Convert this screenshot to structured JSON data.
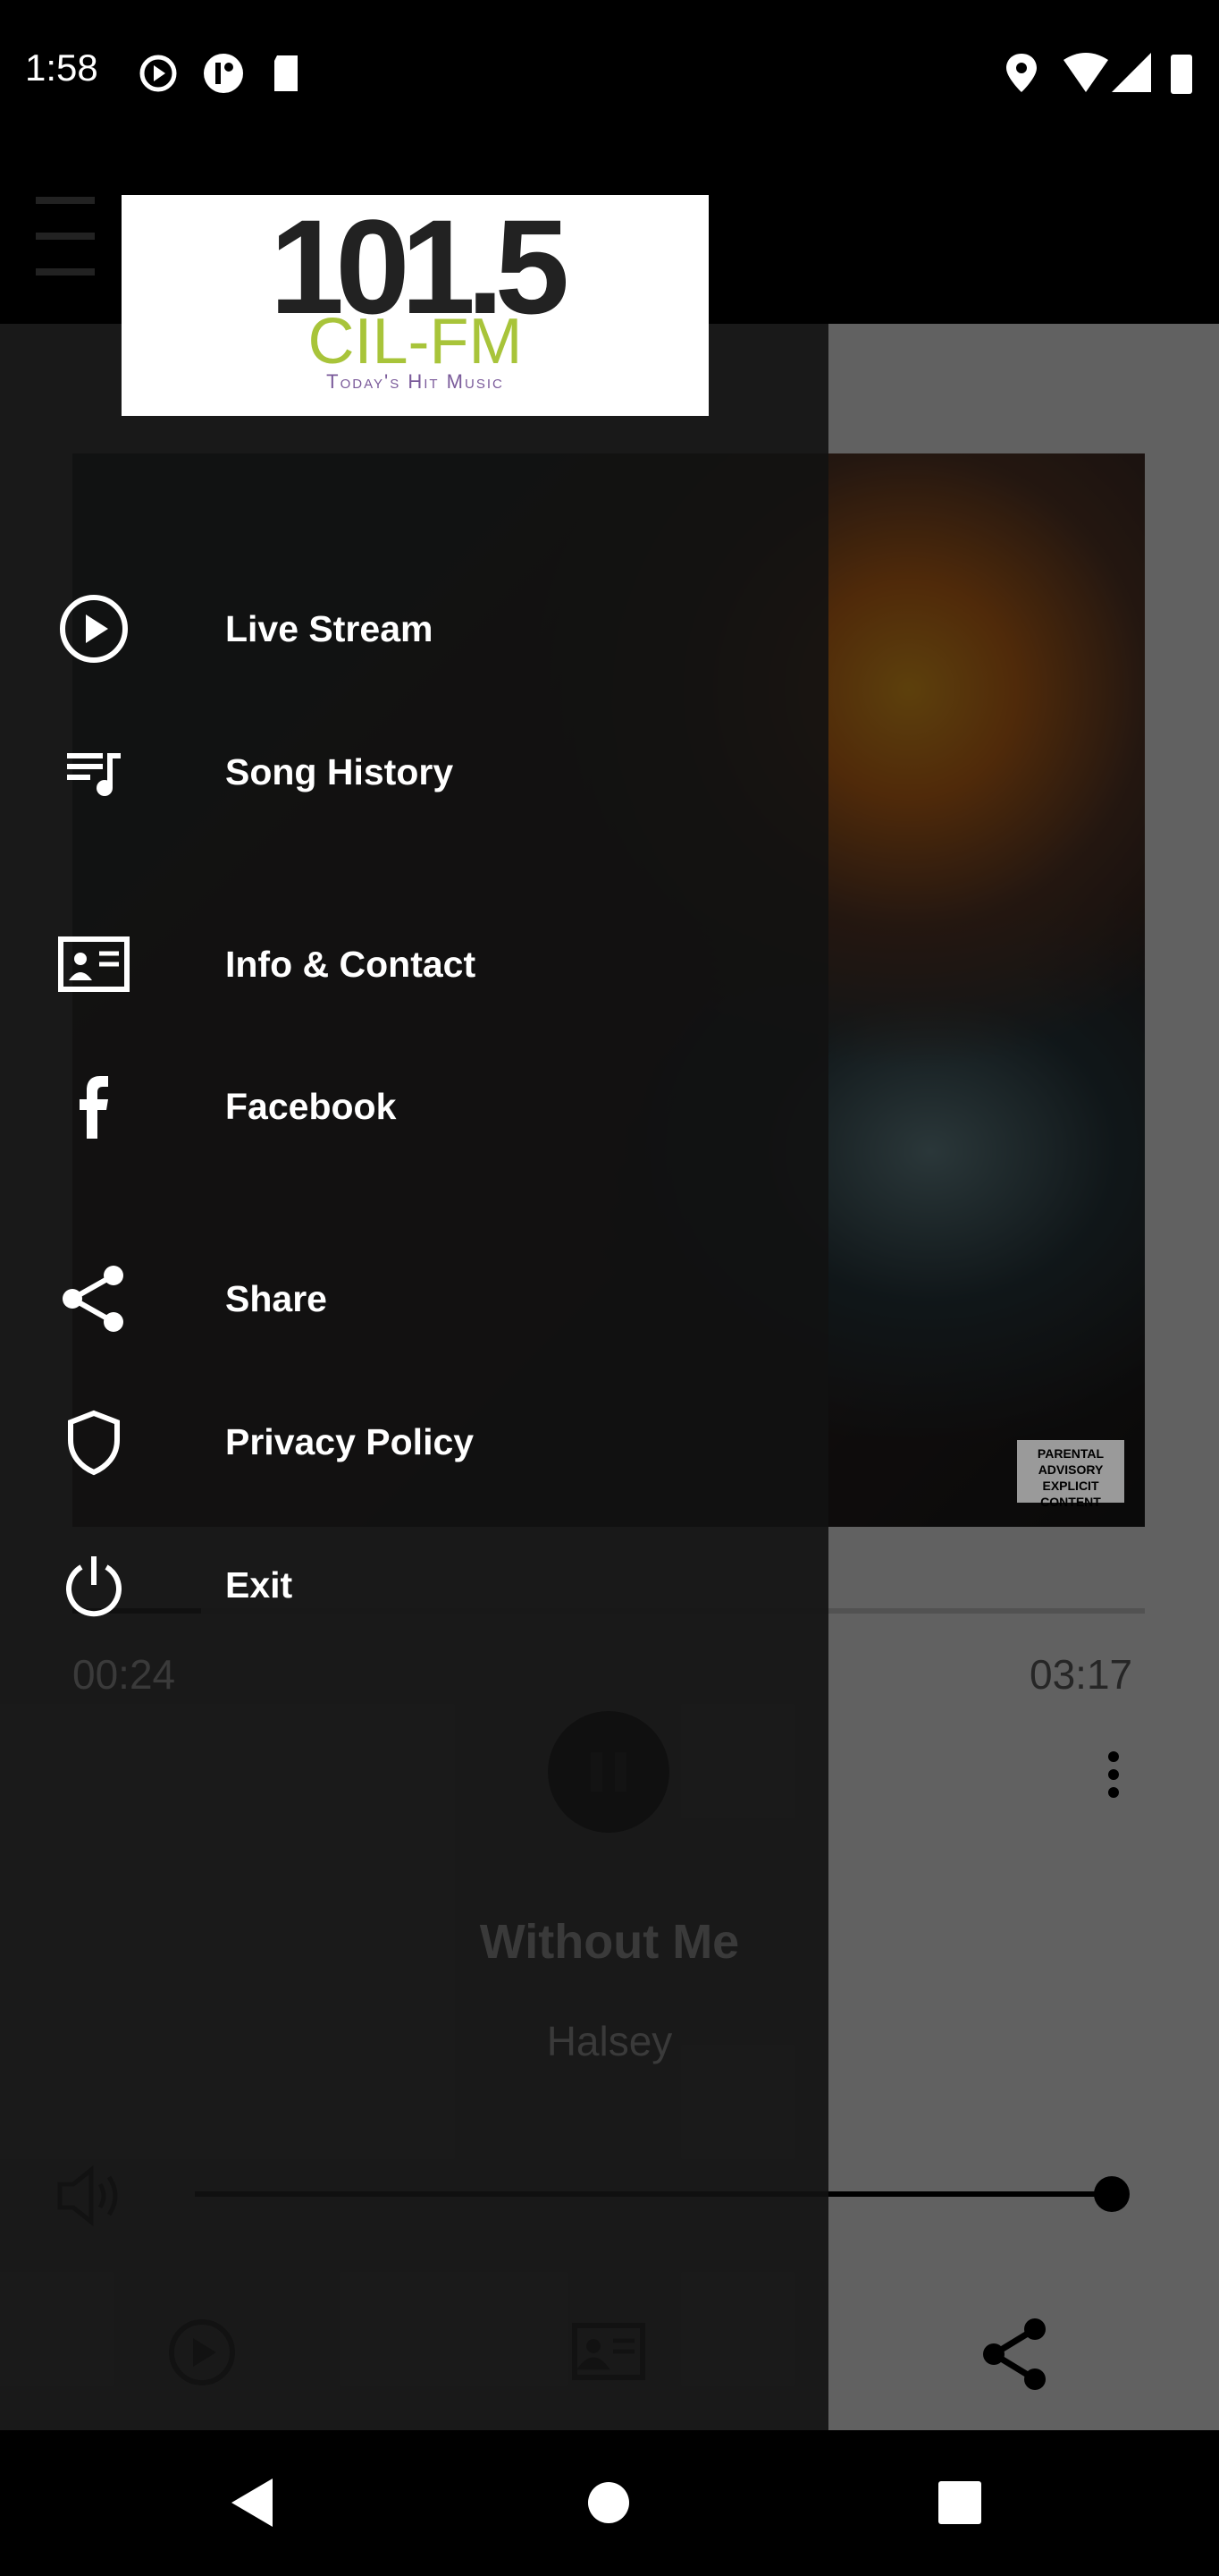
{
  "status_bar": {
    "time": "1:58",
    "icons_left": [
      "play-circle-icon",
      "pocket-casts-icon",
      "sd-card-icon"
    ],
    "icons_right": [
      "location-icon",
      "wifi-icon",
      "signal-icon",
      "battery-icon"
    ]
  },
  "logo": {
    "number": "101.5",
    "call_sign": "CIL-FM",
    "tagline": "Today's Hit Music"
  },
  "drawer": {
    "items": [
      {
        "label": "Live Stream",
        "icon": "play-circle-icon"
      },
      {
        "label": "Song History",
        "icon": "playlist-icon"
      },
      {
        "label": "Info & Contact",
        "icon": "contact-card-icon"
      },
      {
        "label": "Facebook",
        "icon": "facebook-icon"
      },
      {
        "label": "Share",
        "icon": "share-icon"
      },
      {
        "label": "Privacy Policy",
        "icon": "shield-icon"
      },
      {
        "label": "Exit",
        "icon": "power-icon"
      }
    ]
  },
  "player": {
    "elapsed": "00:24",
    "duration": "03:17",
    "progress": 0.12,
    "title": "Without Me",
    "artist": "Halsey",
    "volume": 1.0,
    "advisory": "PARENTAL ADVISORY EXPLICIT CONTENT"
  },
  "bottom_nav": [
    "play-circle-icon",
    "contact-card-icon",
    "share-icon"
  ]
}
